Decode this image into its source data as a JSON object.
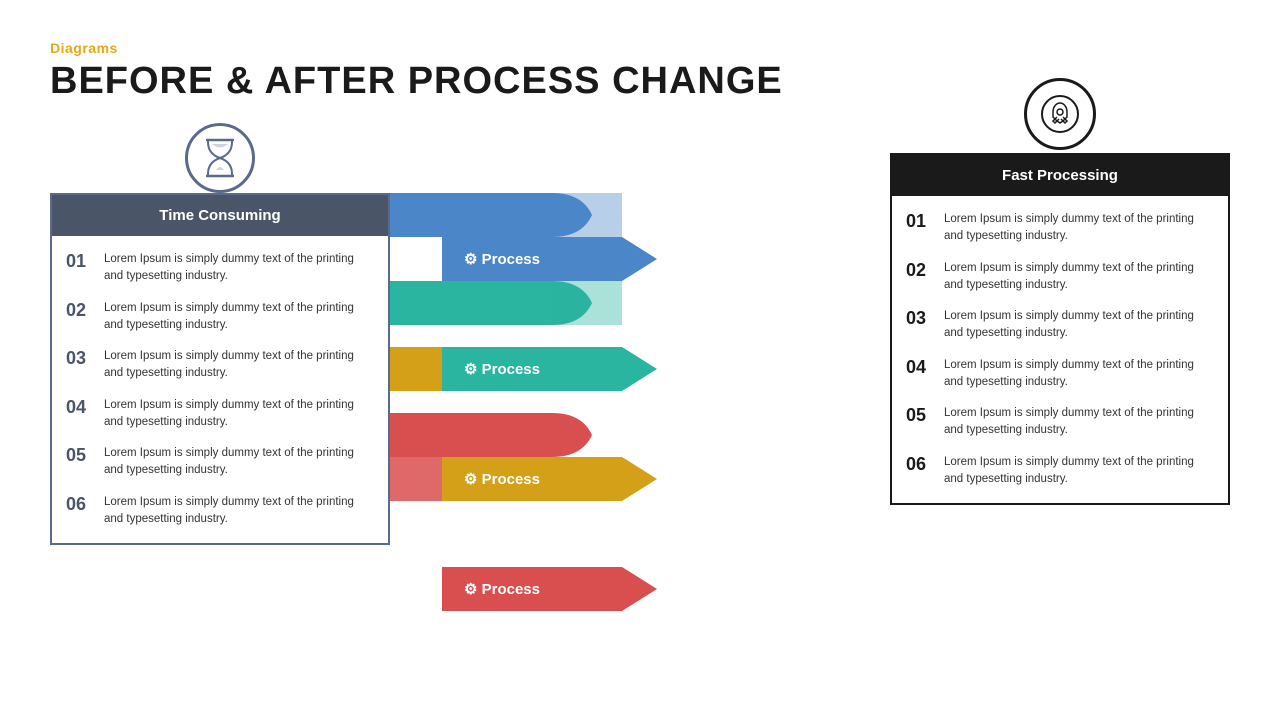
{
  "header": {
    "category": "Diagrams",
    "title": "BEFORE & AFTER PROCESS CHANGE"
  },
  "left_panel": {
    "title": "Time Consuming",
    "items": [
      {
        "num": "01",
        "text": "Lorem Ipsum is simply dummy text of the printing and typesetting industry."
      },
      {
        "num": "02",
        "text": "Lorem Ipsum is simply dummy text of the printing and typesetting industry."
      },
      {
        "num": "03",
        "text": "Lorem Ipsum is simply dummy text of the printing and typesetting industry."
      },
      {
        "num": "04",
        "text": "Lorem Ipsum is simply dummy text of the printing and typesetting industry."
      },
      {
        "num": "05",
        "text": "Lorem Ipsum is simply dummy text of the printing and typesetting industry."
      },
      {
        "num": "06",
        "text": "Lorem Ipsum is simply dummy text of the printing and typesetting industry."
      }
    ]
  },
  "right_panel": {
    "title": "Fast Processing",
    "items": [
      {
        "num": "01",
        "text": "Lorem Ipsum is simply dummy text of the printing and typesetting industry."
      },
      {
        "num": "02",
        "text": "Lorem Ipsum is simply dummy text of the printing and typesetting industry."
      },
      {
        "num": "03",
        "text": "Lorem Ipsum is simply dummy text of the printing and typesetting industry."
      },
      {
        "num": "04",
        "text": "Lorem Ipsum is simply dummy text of the printing and typesetting industry."
      },
      {
        "num": "05",
        "text": "Lorem Ipsum is simply dummy text of the printing and typesetting industry."
      },
      {
        "num": "06",
        "text": "Lorem Ipsum is simply dummy text of the printing and typesetting industry."
      }
    ]
  },
  "process_arrows": [
    {
      "label": "Process",
      "color": "#4a86c8"
    },
    {
      "label": "Process",
      "color": "#2ab5a0"
    },
    {
      "label": "Process",
      "color": "#d4a017"
    },
    {
      "label": "Process",
      "color": "#d94f4f"
    }
  ],
  "colors": {
    "orange": "#e6a817",
    "dark_gray": "#4a5568",
    "black": "#1a1a1a",
    "blue": "#4a86c8",
    "teal": "#2ab5a0",
    "gold": "#d4a017",
    "red": "#d94f4f"
  }
}
